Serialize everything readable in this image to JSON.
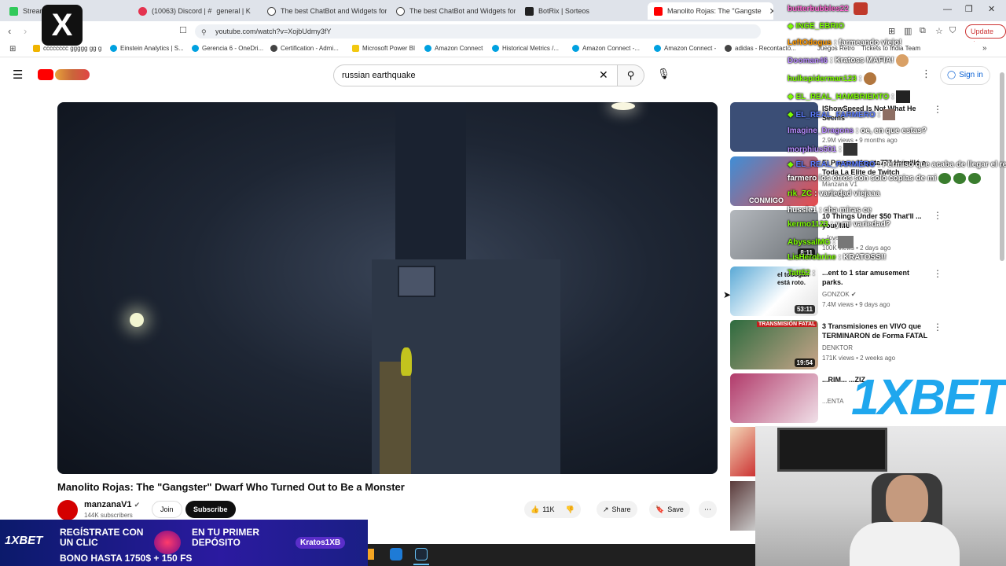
{
  "browser": {
    "tabs": [
      {
        "label": "Stream - ",
        "label2": "rd",
        "color": "#31c95a"
      },
      {
        "label": "(10063) Discord | #",
        "label2": "general | K",
        "color": "#e4334f"
      },
      {
        "label": "The best ChatBot and Widgets for Ki",
        "color": "#444444"
      },
      {
        "label": "The best ChatBot and Widgets for Ki",
        "color": "#444444"
      },
      {
        "label": "BotRix | Sorteos",
        "color": "#222222"
      },
      {
        "label": "Manolito Rojas: The \"Gangste",
        "color": "#ff0000"
      }
    ],
    "url": "youtube.com/watch?v=XojbUdmy3fY",
    "update_label": "Update",
    "bookmarks": [
      {
        "label": "cccccccc ggggg gg g",
        "color": "#f0b400"
      },
      {
        "label": "Einstein Analytics | S...",
        "color": "#00a1e0"
      },
      {
        "label": "Gerencia 6 - OneDri...",
        "color": "#00a1e0"
      },
      {
        "label": "Certification - Admi...",
        "color": "#444444"
      },
      {
        "label": "Microsoft Power BI",
        "color": "#f2c811"
      },
      {
        "label": "Amazon Connect",
        "color": "#00a1e0"
      },
      {
        "label": "Historical Metrics /...",
        "color": "#00a1e0"
      },
      {
        "label": "Amazon Connect -...",
        "color": "#00a1e0"
      },
      {
        "label": "Amazon Connect -",
        "color": "#00a1e0"
      },
      {
        "label": "adidas - Recontacto...",
        "color": "#444444"
      },
      {
        "label": "Juegos Retro",
        "color": "#444444"
      },
      {
        "label": "Tickets to India Team",
        "color": "#444444"
      }
    ]
  },
  "youtube": {
    "search_query": "russian earthquake",
    "signin_label": "Sign in",
    "video": {
      "title": "Manolito Rojas: The \"Gangster\" Dwarf Who Turned Out to Be a Monster",
      "channel": "manzanaV1",
      "subscribers": "144K subscribers",
      "join_label": "Join",
      "subscribe_label": "Subscribe",
      "likes": "11K",
      "share_label": "Share",
      "save_label": "Save"
    },
    "recommendations": [
      {
        "title": "IShowSpeed Is Not What He Seems",
        "channel": "",
        "meta": "2.9M views • 9 months ago",
        "duration": "",
        "thumb": "#3b4e76"
      },
      {
        "title": "El Payaso Vegeta777 Humilló a Toda La Elite de Twitch",
        "channel": "Manzana V1",
        "meta": "...ths ago",
        "duration": "",
        "thumb": "#3f8ed6"
      },
      {
        "title": "10 Things Under $50 That'll ... your life",
        "channel": "...loves",
        "meta": "100K views • 2 days ago",
        "duration": "8:11",
        "thumb": "#9aa0a6"
      },
      {
        "title": "...ent to 1 star amusement parks.",
        "channel": "GONZOK",
        "meta": "7.4M views • 9 days ago",
        "duration": "53:11",
        "thumb": "#5aa9d6"
      },
      {
        "title": "3 Transmisiones en VIVO que TERMINARON de Forma FATAL",
        "channel": "DENKTOR",
        "meta": "171K views • 2 weeks ago",
        "duration": "19:54",
        "thumb": "#2d6b3e"
      },
      {
        "title": "...RIM... ...ZIZ",
        "channel": "...ENTA",
        "meta": "",
        "duration": "",
        "thumb": "#b13a6a"
      }
    ]
  },
  "chat": [
    {
      "user": "butterbubbles22",
      "msg": "",
      "color": "#ff6ad5"
    },
    {
      "user": "INGE_EBRIO",
      "msg": "",
      "color": "#7CFC00"
    },
    {
      "user": "LeftOdogus",
      "msg": ": farmeando viejo!",
      "color": "#ff9900"
    },
    {
      "user": "Dooman46",
      "msg": ": Kratoss MAFIA!",
      "color": "#b98cff"
    },
    {
      "user": "hulkspiderman123",
      "msg": ":",
      "color": "#7CFC00"
    },
    {
      "user": "EL_REAL_HAMBRIENTO",
      "msg": ":",
      "color": "#7CFC00"
    },
    {
      "user": "EL_REAL_FARMERO",
      "msg": ":",
      "color": "#5b7cff"
    },
    {
      "user": "Imagine_Dragons",
      "msg": ": oe, en que estas?",
      "color": "#b98cff"
    },
    {
      "user": "morphius501",
      "msg": ":",
      "color": "#b98cff"
    },
    {
      "user": "EL_REAL_FARMERO",
      "msg": ": Permiso que acaba de llegar el real",
      "color": "#5b7cff"
    },
    {
      "user": "",
      "msg": "farmero los otros son solo copias de mi",
      "color": "#ffffff"
    },
    {
      "user": "rik_ZC",
      "msg": ": variedad viejaaa",
      "color": "#7CFC00"
    },
    {
      "user": "hussle1",
      "msg": ": cha miras ce",
      "color": "#ffffff"
    },
    {
      "user": "kermo1123",
      "msg": ": y mi variedad?",
      "color": "#7CFC00"
    },
    {
      "user": "AbyssalMG",
      "msg": ":",
      "color": "#7CFC00"
    },
    {
      "user": "LisHerobrine",
      "msg": ": KRATOSS!!",
      "color": "#7CFC00"
    },
    {
      "user": "Tatt52",
      "msg": ":",
      "color": "#7CFC00"
    }
  ],
  "overlay": {
    "bet_text": "1XBET",
    "banner_line1": "REGÍSTRATE CON UN CLIC",
    "banner_line2": "EN TU PRIMER DEPÓSITO",
    "banner_line3": "BONO HASTA 1750$ + 150 FS",
    "banner_logo": "1XBET",
    "banner_tag": "Kratos1XB",
    "thumb_label_1": "CONMIGO",
    "thumb_label_2": "el tobogán está roto.",
    "thumb_label_3": "TRANSMISIÓN FATAL"
  }
}
